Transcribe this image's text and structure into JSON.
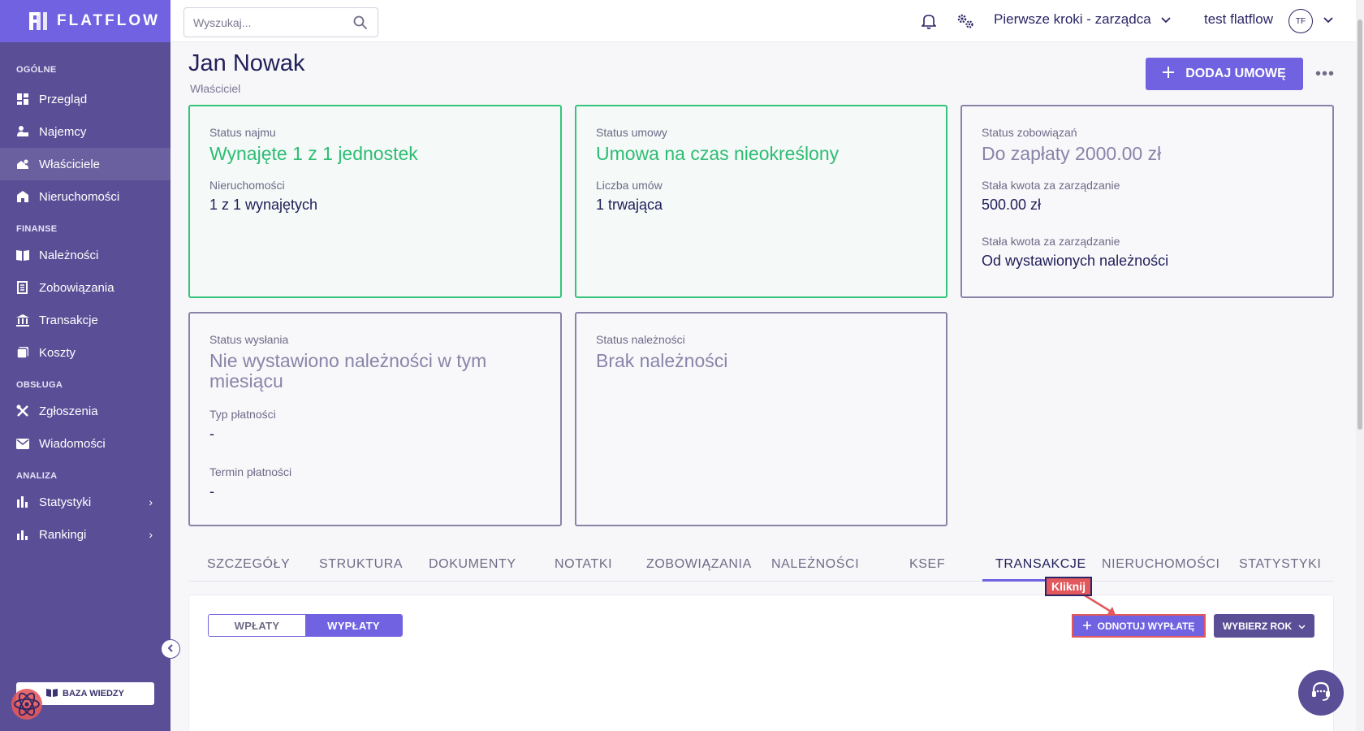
{
  "brand": {
    "name": "FLATFLOW"
  },
  "sidebar": {
    "sections": [
      {
        "title": "OGÓLNE",
        "items": [
          {
            "label": "Przegląd",
            "icon": "dashboard-icon"
          },
          {
            "label": "Najemcy",
            "icon": "tenant-icon"
          },
          {
            "label": "Właściciele",
            "icon": "owner-icon",
            "active": true
          },
          {
            "label": "Nieruchomości",
            "icon": "building-icon"
          }
        ]
      },
      {
        "title": "FINANSE",
        "items": [
          {
            "label": "Należności",
            "icon": "book-icon"
          },
          {
            "label": "Zobowiązania",
            "icon": "document-icon"
          },
          {
            "label": "Transakcje",
            "icon": "bank-icon"
          },
          {
            "label": "Koszty",
            "icon": "costs-icon"
          }
        ]
      },
      {
        "title": "OBSŁUGA",
        "items": [
          {
            "label": "Zgłoszenia",
            "icon": "tools-icon"
          },
          {
            "label": "Wiadomości",
            "icon": "mail-icon"
          }
        ]
      },
      {
        "title": "ANALIZA",
        "items": [
          {
            "label": "Statystyki",
            "icon": "bar-chart-icon",
            "has_submenu": true
          },
          {
            "label": "Rankingi",
            "icon": "ranking-icon",
            "has_submenu": true
          }
        ]
      }
    ],
    "knowledge_base": "BAZA WIEDZY"
  },
  "topbar": {
    "search_placeholder": "Wyszukaj...",
    "company": "Pierwsze kroki - zarządca",
    "user_name": "test flatflow",
    "user_initials": "TF"
  },
  "header": {
    "title": "Jan Nowak",
    "subtitle": "Właściciel",
    "add_button": "DODAJ UMOWĘ"
  },
  "cards": [
    {
      "label": "Status najmu",
      "big": "Wynajęte 1 z 1 jednostek",
      "fields": [
        {
          "label": "Nieruchomości",
          "value": "1 z 1 wynajętych"
        }
      ]
    },
    {
      "label": "Status umowy",
      "big": "Umowa na czas nieokreślony",
      "fields": [
        {
          "label": "Liczba umów",
          "value": "1 trwająca"
        }
      ]
    },
    {
      "label": "Status zobowiązań",
      "big": "Do zapłaty 2000.00 zł",
      "fields": [
        {
          "label": "Stała kwota za zarządzanie",
          "value": "500.00 zł"
        },
        {
          "label": "Stała kwota za zarządzanie",
          "value": "Od wystawionych należności"
        }
      ]
    },
    {
      "label": "Status wysłania",
      "big": "Nie wystawiono należności w tym miesiącu",
      "fields": [
        {
          "label": "Typ płatności",
          "value": "-"
        },
        {
          "label": "Termin płatności",
          "value": "-"
        }
      ]
    },
    {
      "label": "Status należności",
      "big": "Brak należności",
      "fields": []
    }
  ],
  "tabs": [
    "SZCZEGÓŁY",
    "STRUKTURA",
    "DOKUMENTY",
    "NOTATKI",
    "ZOBOWIĄZANIA",
    "NALEŻNOŚCI",
    "KSEF",
    "TRANSAKCJE",
    "NIERUCHOMOŚCI",
    "STATYSTYKI"
  ],
  "active_tab": "TRANSAKCJE",
  "transactions": {
    "toggle": [
      "WPŁATY",
      "WYPŁATY"
    ],
    "active_toggle": "WYPŁATY",
    "record_button": "ODNOTUJ WYPŁATĘ",
    "year_button": "WYBIERZ ROK"
  },
  "annotation": {
    "tooltip": "Kliknij"
  },
  "colors": {
    "sidebar": "#5a4f97",
    "accent": "#7062e0",
    "success": "#2dbd73",
    "highlight": "#e2585c"
  }
}
